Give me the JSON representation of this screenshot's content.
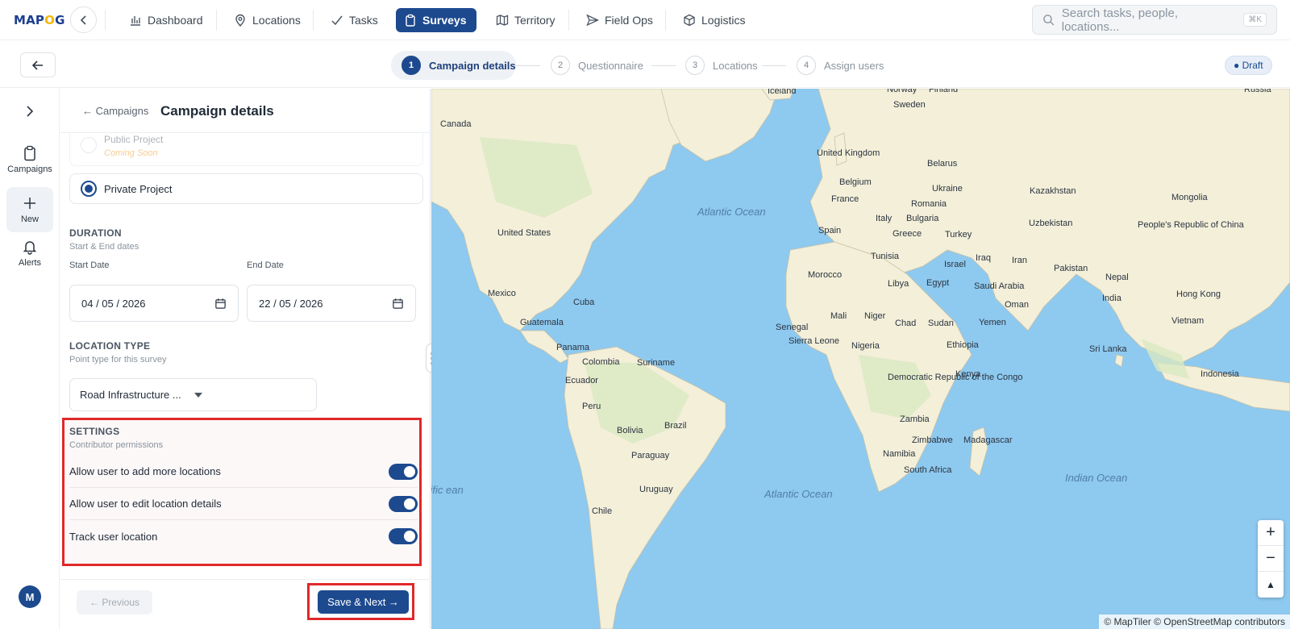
{
  "topbar": {
    "logo": "MAPOG",
    "nav": [
      {
        "label": "Dashboard",
        "icon": "bar-chart-icon"
      },
      {
        "label": "Locations",
        "icon": "pin-icon"
      },
      {
        "label": "Tasks",
        "icon": "check-icon"
      },
      {
        "label": "Surveys",
        "icon": "clipboard-icon",
        "active": true
      },
      {
        "label": "Territory",
        "icon": "map-icon"
      },
      {
        "label": "Field Ops",
        "icon": "send-icon"
      },
      {
        "label": "Logistics",
        "icon": "box-icon"
      }
    ],
    "search_placeholder": "Search tasks, people, locations...",
    "search_shortcut": "⌘K"
  },
  "stepper": {
    "steps": [
      {
        "num": "1",
        "label": "Campaign details"
      },
      {
        "num": "2",
        "label": "Questionnaire"
      },
      {
        "num": "3",
        "label": "Locations"
      },
      {
        "num": "4",
        "label": "Assign users"
      }
    ],
    "status": "● Draft"
  },
  "rail": {
    "items": [
      {
        "label": "Campaigns",
        "icon": "clipboard-icon"
      },
      {
        "label": "New",
        "icon": "plus-icon"
      },
      {
        "label": "Alerts",
        "icon": "bell-icon"
      }
    ],
    "avatar": "M"
  },
  "panel": {
    "crumb": "← Campaigns",
    "title": "Campaign details",
    "public_project": {
      "label": "Public Project",
      "note": "Coming Soon"
    },
    "private_project": {
      "label": "Private Project"
    },
    "duration": {
      "title": "DURATION",
      "subtitle": "Start & End dates",
      "start_label": "Start Date",
      "start_value": "04 / 05 / 2026",
      "end_label": "End Date",
      "end_value": "22 / 05 / 2026"
    },
    "location_type": {
      "title": "LOCATION TYPE",
      "subtitle": "Point type for this survey",
      "value": "Road Infrastructure ..."
    },
    "settings": {
      "title": "SETTINGS",
      "subtitle": "Contributor permissions",
      "toggles": [
        {
          "label": "Allow user to add more locations",
          "on": true
        },
        {
          "label": "Allow user to edit location details",
          "on": true
        },
        {
          "label": "Track user location",
          "on": true
        }
      ]
    },
    "footer": {
      "previous": "← Previous",
      "next": "Save & Next →"
    }
  },
  "map": {
    "labels": [
      {
        "text": "Canada"
      },
      {
        "text": "Sweden"
      },
      {
        "text": "Iceland"
      },
      {
        "text": "Norway"
      },
      {
        "text": "Finland"
      },
      {
        "text": "Russia"
      },
      {
        "text": "United Kingdom"
      },
      {
        "text": "Belgium"
      },
      {
        "text": "France"
      },
      {
        "text": "Belarus"
      },
      {
        "text": "Ukraine"
      },
      {
        "text": "Romania"
      },
      {
        "text": "Bulgaria"
      },
      {
        "text": "Italy"
      },
      {
        "text": "Spain"
      },
      {
        "text": "Greece"
      },
      {
        "text": "Turkey"
      },
      {
        "text": "Kazakhstan"
      },
      {
        "text": "Mongolia"
      },
      {
        "text": "Uzbekistan"
      },
      {
        "text": "People's Republic of China"
      },
      {
        "text": "United States"
      },
      {
        "text": "Mexico"
      },
      {
        "text": "Cuba"
      },
      {
        "text": "Guatemala"
      },
      {
        "text": "Panama"
      },
      {
        "text": "Colombia"
      },
      {
        "text": "Suriname"
      },
      {
        "text": "Ecuador"
      },
      {
        "text": "Peru"
      },
      {
        "text": "Brazil"
      },
      {
        "text": "Bolivia"
      },
      {
        "text": "Paraguay"
      },
      {
        "text": "Uruguay"
      },
      {
        "text": "Chile"
      },
      {
        "text": "Tunisia"
      },
      {
        "text": "Morocco"
      },
      {
        "text": "Libya"
      },
      {
        "text": "Egypt"
      },
      {
        "text": "Israel"
      },
      {
        "text": "Iraq"
      },
      {
        "text": "Iran"
      },
      {
        "text": "Saudi Arabia"
      },
      {
        "text": "Oman"
      },
      {
        "text": "Yemen"
      },
      {
        "text": "Pakistan"
      },
      {
        "text": "Nepal"
      },
      {
        "text": "India"
      },
      {
        "text": "Hong Kong"
      },
      {
        "text": "Vietnam"
      },
      {
        "text": "Sri Lanka"
      },
      {
        "text": "Indonesia"
      },
      {
        "text": "Mali"
      },
      {
        "text": "Niger"
      },
      {
        "text": "Chad"
      },
      {
        "text": "Sudan"
      },
      {
        "text": "Senegal"
      },
      {
        "text": "Sierra Leone"
      },
      {
        "text": "Nigeria"
      },
      {
        "text": "Ethiopia"
      },
      {
        "text": "Kenya"
      },
      {
        "text": "Democratic Republic of the Congo"
      },
      {
        "text": "Zambia"
      },
      {
        "text": "Zimbabwe"
      },
      {
        "text": "Madagascar"
      },
      {
        "text": "Namibia"
      },
      {
        "text": "South Africa"
      }
    ],
    "oceans": [
      "Atlantic Ocean",
      "Atlantic Ocean",
      "Indian Ocean",
      "cific ean"
    ],
    "attribution": "© MapTiler © OpenStreetMap contributors",
    "zoom_in": "+",
    "zoom_out": "−",
    "compass": "▲"
  }
}
